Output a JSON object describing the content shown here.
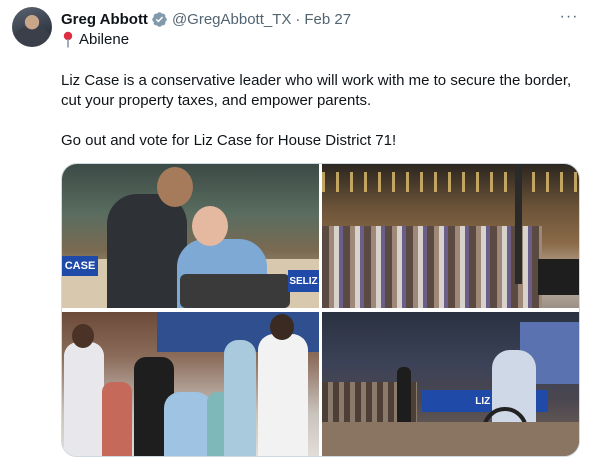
{
  "author": {
    "name": "Greg Abbott",
    "handle": "@GregAbbott_TX",
    "separator": "·",
    "date": "Feb 27",
    "verified_color": "#829aab"
  },
  "location": {
    "icon": "pin-icon",
    "text": "Abilene"
  },
  "more_menu": {
    "icon": "more-icon",
    "label": "···"
  },
  "tweet": {
    "paragraphs": [
      "Liz Case is a conservative leader who will work with me to secure the border, cut your property taxes, and empower parents.",
      "Go out and vote for Liz Case for House District 71!"
    ]
  },
  "media": {
    "signs": {
      "case": "CASE",
      "selize": "SELIZ",
      "lizcase": "LIZ CASE"
    }
  },
  "colors": {
    "text": "#0f1419",
    "secondary": "#536471",
    "border": "#cfd9de",
    "sign_blue": "#1f4aa8"
  }
}
